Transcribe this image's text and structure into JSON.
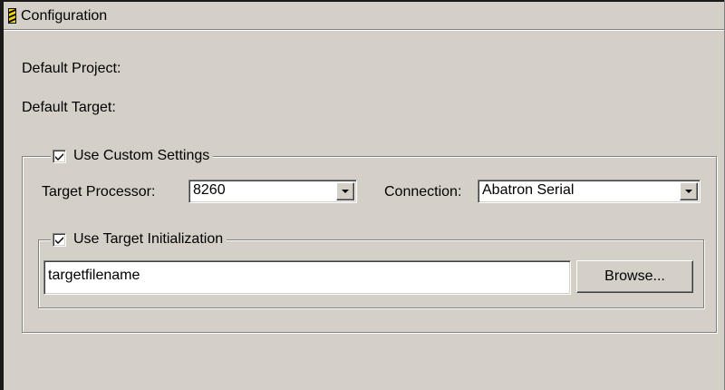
{
  "window": {
    "title": "Configuration",
    "icon": "config-app-icon"
  },
  "defaults": {
    "project_label": "Default Project:",
    "target_label": "Default Target:"
  },
  "custom_settings": {
    "label": "Use Custom Settings",
    "checked": true,
    "processor_label": "Target Processor:",
    "processor_value": "8260",
    "connection_label": "Connection:",
    "connection_value": "Abatron Serial"
  },
  "target_init": {
    "label": "Use Target Initialization",
    "checked": true,
    "filename_value": "targetfilename",
    "browse_label": "Browse..."
  },
  "colors": {
    "face": "#d4d0c8",
    "shadow": "#808080",
    "highlight": "#ffffff",
    "icon_accent": "#f7d600"
  }
}
